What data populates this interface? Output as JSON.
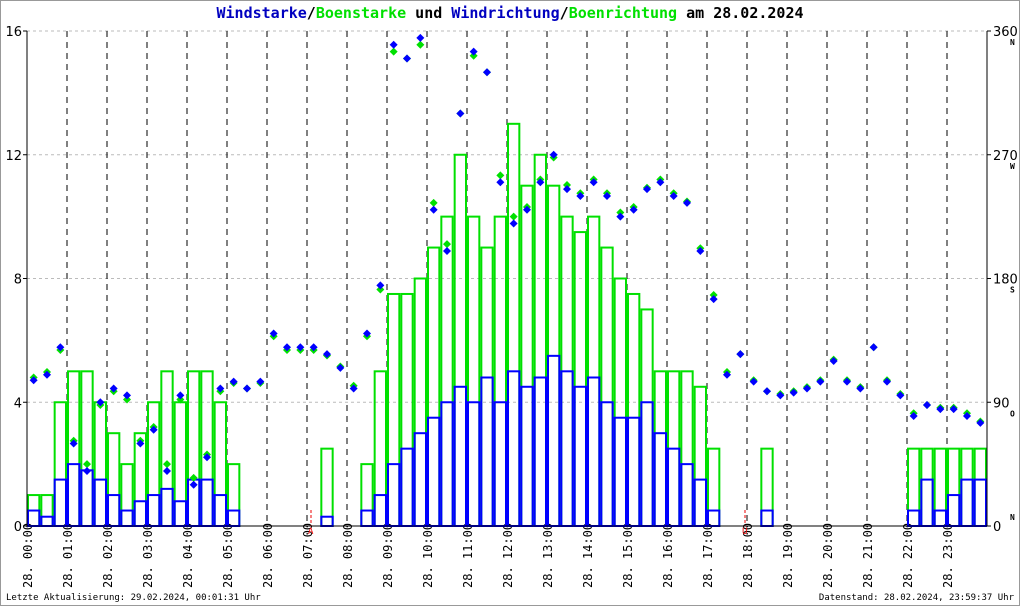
{
  "chart_data": {
    "type": "bar+scatter",
    "title_parts": [
      {
        "text": "Windstarke",
        "color": "#0000c0"
      },
      {
        "text": "/",
        "color": "#000000"
      },
      {
        "text": "Boenstarke",
        "color": "#00e000"
      },
      {
        "text": " und ",
        "color": "#000000"
      },
      {
        "text": "Windrichtung",
        "color": "#0000c0"
      },
      {
        "text": "/",
        "color": "#000000"
      },
      {
        "text": "Boenrichtung",
        "color": "#00e000"
      },
      {
        "text": " am 28.02.2024",
        "color": "#000000"
      }
    ],
    "ylim_left": [
      0,
      16
    ],
    "yticks_left": [
      "0",
      "4",
      "8",
      "12",
      "16"
    ],
    "ylim_right": [
      0,
      360
    ],
    "yticks_right": [
      "0",
      "90",
      "180",
      "270",
      "360"
    ],
    "compass_labels": [
      "N",
      "O",
      "S",
      "W",
      "N"
    ],
    "xlim_hours": [
      0,
      24
    ],
    "xticks": [
      "28. 00:00",
      "28. 01:00",
      "28. 02:00",
      "28. 03:00",
      "28. 04:00",
      "28. 05:00",
      "28. 06:00",
      "28. 07:00",
      "28. 08:00",
      "28. 09:00",
      "28. 10:00",
      "28. 11:00",
      "28. 12:00",
      "28. 13:00",
      "28. 14:00",
      "28. 15:00",
      "28. 16:00",
      "28. 17:00",
      "28. 18:00",
      "28. 19:00",
      "28. 20:00",
      "28. 21:00",
      "28. 22:00",
      "28. 23:00"
    ],
    "markers": [
      {
        "label": "A",
        "hour": 7.1
      },
      {
        "label": "U",
        "hour": 17.95
      }
    ],
    "sample_interval_minutes": 20,
    "series": [
      {
        "name": "Windstarke",
        "color": "#0000ff",
        "kind": "bar",
        "values": [
          0.5,
          0.3,
          1.5,
          2,
          1.8,
          1.5,
          1,
          0.5,
          0.8,
          1,
          1.2,
          0.8,
          1.5,
          1.5,
          1,
          0.5,
          0,
          0,
          0,
          0,
          0,
          0,
          0.3,
          0,
          0,
          0.5,
          1,
          2,
          2.5,
          3,
          3.5,
          4,
          4.5,
          4,
          4.8,
          4,
          5,
          4.5,
          4.8,
          5.5,
          5,
          4.5,
          4.8,
          4,
          3.5,
          3.5,
          4,
          3,
          2.5,
          2,
          1.5,
          0.5,
          0,
          0,
          0,
          0.5,
          0,
          0,
          0,
          0,
          0,
          0,
          0,
          0,
          0,
          0,
          0.5,
          1.5,
          0.5,
          1,
          1.5,
          1.5
        ]
      },
      {
        "name": "Boenstarke",
        "color": "#00e000",
        "kind": "bar",
        "values": [
          1,
          1,
          4,
          5,
          5,
          4,
          3,
          2,
          3,
          4,
          5,
          4,
          5,
          5,
          4,
          2,
          0,
          0,
          0,
          0,
          0,
          0,
          2.5,
          0,
          0,
          2,
          5,
          7.5,
          7.5,
          8,
          9,
          10,
          12,
          10,
          9,
          10,
          13,
          11,
          12,
          11,
          10,
          9.5,
          10,
          9,
          8,
          7.5,
          7,
          5,
          5,
          5,
          4.5,
          2.5,
          0,
          0,
          0,
          2.5,
          0,
          0,
          0,
          0,
          0,
          0,
          0,
          0,
          0,
          0,
          2.5,
          2.5,
          2.5,
          2.5,
          2.5,
          2.5
        ]
      },
      {
        "name": "Boenrichtung",
        "color": "#00e000",
        "kind": "scatter",
        "values": [
          108,
          112,
          128,
          62,
          45,
          88,
          98,
          92,
          62,
          72,
          45,
          92,
          35,
          52,
          98,
          104,
          100,
          104,
          138,
          128,
          128,
          128,
          124,
          116,
          102,
          138,
          172,
          345,
          340,
          350,
          235,
          205,
          300,
          342,
          330,
          255,
          225,
          232,
          252,
          268,
          248,
          242,
          252,
          242,
          228,
          232,
          246,
          252,
          242,
          236,
          202,
          168,
          112,
          125,
          106,
          98,
          96,
          98,
          101,
          106,
          121,
          106,
          101,
          130,
          106,
          96,
          82,
          88,
          86,
          86,
          82,
          76
        ]
      },
      {
        "name": "Windrichtung",
        "color": "#0000ff",
        "kind": "scatter",
        "values": [
          106,
          110,
          130,
          60,
          40,
          90,
          100,
          95,
          60,
          70,
          40,
          95,
          30,
          50,
          100,
          105,
          100,
          105,
          140,
          130,
          130,
          130,
          125,
          115,
          100,
          140,
          175,
          350,
          340,
          355,
          230,
          200,
          300,
          345,
          330,
          250,
          220,
          230,
          250,
          270,
          245,
          240,
          250,
          240,
          225,
          230,
          245,
          250,
          240,
          235,
          200,
          165,
          110,
          125,
          105,
          98,
          95,
          97,
          100,
          105,
          120,
          105,
          100,
          130,
          105,
          95,
          80,
          88,
          85,
          85,
          80,
          75
        ]
      }
    ]
  },
  "footer": {
    "left": "Letzte Aktualisierung: 29.02.2024, 00:01:31 Uhr",
    "right": "Datenstand: 28.02.2024, 23:59:37 Uhr"
  }
}
